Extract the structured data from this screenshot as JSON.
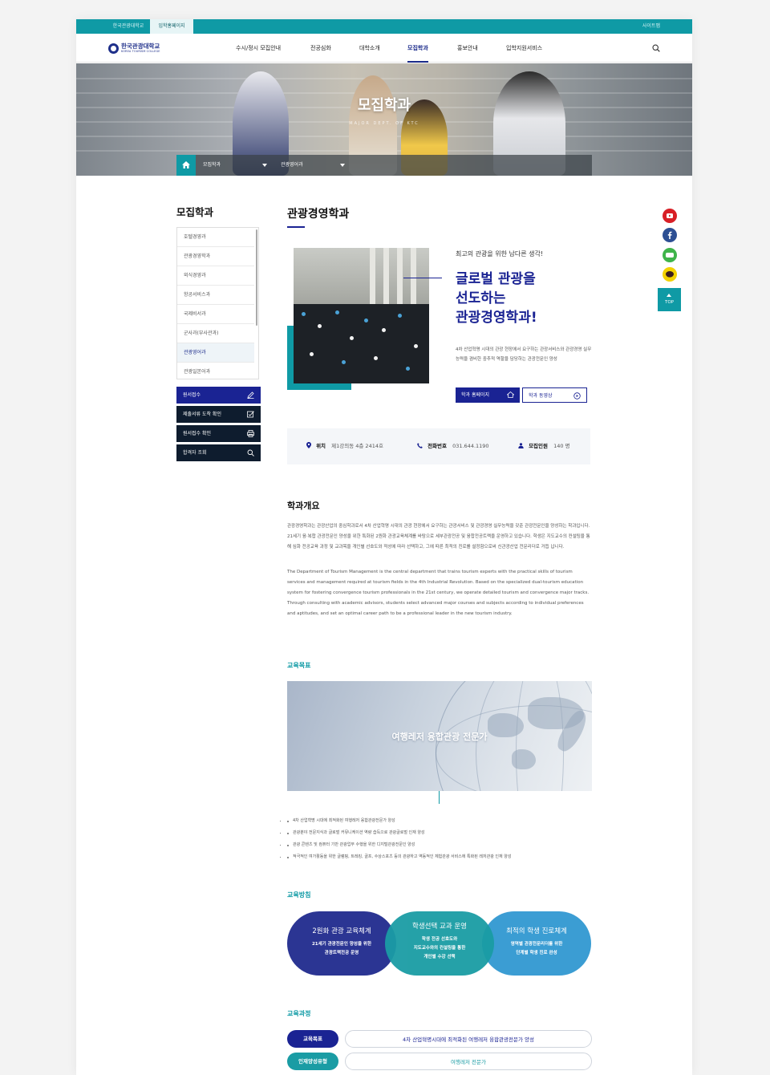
{
  "topbar": {
    "links": [
      "한국관광대학교",
      "입학홍페이지"
    ],
    "sitemap": "사이트맵"
  },
  "logo": {
    "ko": "한국관광대학교",
    "en": "KOREA TOURISM COLLEGE"
  },
  "gnb": [
    "수시/정시 모집안내",
    "전공심화",
    "대학소개",
    "모집학과",
    "홍보안내",
    "입학지원서비스"
  ],
  "hero": {
    "title": "모집학과",
    "subtitle": "MAJOR DEPT. OF KTC",
    "crumb1": "모집학과",
    "crumb2": "관광영어과"
  },
  "sidebar": {
    "title": "모집학과",
    "items": [
      "호텔경영과",
      "관광경영학과",
      "외식경영과",
      "항공서비스과",
      "국제비서과",
      "군사과(부사관과)",
      "관광영어과",
      "관광일본어과"
    ],
    "active_index": 6,
    "buttons": [
      "원서접수",
      "제출서류 도착 확인",
      "원서접수 확인",
      "합격자 조회"
    ]
  },
  "main": {
    "title": "관광경영학과",
    "slogan_small": "최고의 관광을 위한 남다른 생각!",
    "slogan_lines": [
      "글로벌 관광을",
      "선도하는",
      "관광경영학과!"
    ],
    "slogan_desc": "4차 산업혁명 시대의 관광 현장에서 요구하는 관광서비스와 관광경영 실무능력을 겸비한 중추적 역할을 담당하는 관광전문인 양성",
    "btn_home": "학과 홈페이지",
    "btn_video": "학과 동영상"
  },
  "info": {
    "location_label": "위치",
    "location_value": "제1강의동 4층 2414호",
    "phone_label": "전화번호",
    "phone_value": "031.644.1190",
    "quota_label": "모집인원",
    "quota_value": "140 명"
  },
  "overview": {
    "title": "학과개요",
    "ko": "관광경영학과는 관광산업의 중심학과로서 4차 산업혁명 시대의 관광 현장에서 요구하는 관광서비스 및 관광경영 실무능력을 갖춘 관광전문인을 양성하는 학과입니다. 21세기 융·복합 관광전문인 양성을 위한 특화된 2원화 관광교육체계를 바탕으로 세부관광전공 및 융합전공트랙을 운영하고 있습니다. 학생은 지도교수의 컨설팅을 통해 심화 전공교육 과정 및 교과목을 개인별 선호도와 적성에 따라 선택하고, 그에 따른 최적의 진로를 설정함으로써 신관광산업 전문리더로 거듭 납니다.",
    "en": "The Department of Tourism Management is the central department that trains tourism experts with the practical skills of tourism services and management required at tourism fields in the 4th Industrial Revolution. Based on the specialized dual-tourism education system for fostering convergence tourism professionals in the 21st century, we operate detailed tourism and convergence major tracks. Through consulting with academic advisors, students select advanced major courses and subjects according to individual preferences and aptitudes, and set an optimal career path to be a professional leader in the new tourism industry."
  },
  "goals": {
    "title": "교육목표",
    "banner": "여행레저 융합관광 전문가",
    "items": [
      "4차 산업혁명 시대에 최적화된 여행레저 융합관광전문가 양성",
      "관광분야 전문지식과 글로벌 커뮤니케이션 역량 습득으로 관광글로벌 인재 양성",
      "관광 콘텐츠 및 컴퓨터 기반 관광업무 수행을 위한 디지털관광전문인 양성",
      "적극적인 여가활동을 위한 글램핑, 트레킹, 골프, 수상스포츠 등의 관광하고 역동적인 체험관광 서비스에 특화된 레저관광 인재 양성"
    ]
  },
  "policy": {
    "title": "교육방침",
    "circles": [
      {
        "title": "2원화 관광 교육체계",
        "desc1": "21세기 관광전문인 양성을 위한",
        "desc2": "관광트랙전공 운영"
      },
      {
        "title": "학생선택 교과 운영",
        "desc1": "학생 전공 선호도와",
        "desc2": "지도교수와의 컨설팅을 통한",
        "desc3": "개인별 수강 선택"
      },
      {
        "title": "최적의 학생 진로체계",
        "desc1": "영역별 관광전문리더를 위한",
        "desc2": "단계별 학생 진로 완성"
      }
    ]
  },
  "curriculum": {
    "title": "교육과정",
    "row1_label": "교육목표",
    "row1_value": "4차 산업혁명시대에 최적화된 여행레저 융합관광전문가 양성",
    "row2_label": "인재양성유형",
    "row2_value": "여행레저 전문가"
  },
  "quick": {
    "icons": [
      "youtube-icon",
      "facebook-icon",
      "blog-icon",
      "kakaotalk-icon"
    ],
    "top": "TOP",
    "colors": {
      "youtube": "#d81f26",
      "facebook": "#2d4f93",
      "blog": "#3fb44a",
      "kakao": "#f2d200"
    }
  },
  "colors": {
    "navy": "#1a2393",
    "teal": "#0f9aa5"
  }
}
